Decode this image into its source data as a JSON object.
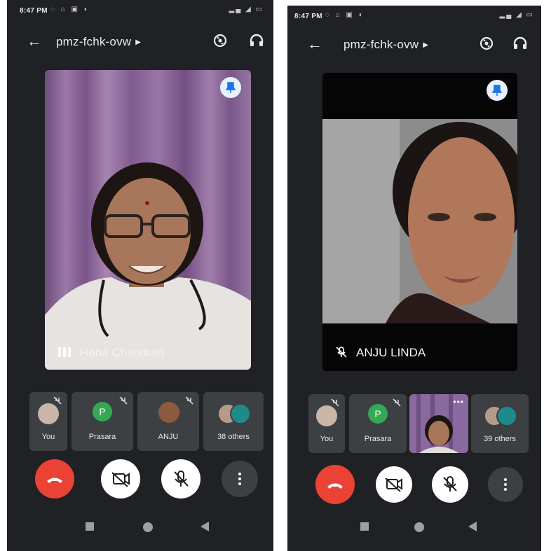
{
  "left": {
    "status_time": "8:47 PM",
    "meeting_code": "pmz-fchk-ovw",
    "speaker_name": "Hena Chandran",
    "tiles": [
      {
        "label": "You"
      },
      {
        "label": "Prasara",
        "initial": "P"
      },
      {
        "label": "ANJU"
      },
      {
        "label": "38 others"
      }
    ]
  },
  "right": {
    "status_time": "8:47 PM",
    "meeting_code": "pmz-fchk-ovw",
    "speaker_name": "ANJU LINDA",
    "tiles": [
      {
        "label": "You"
      },
      {
        "label": "Prasara",
        "initial": "P"
      },
      {
        "label": ""
      },
      {
        "label": "39 others"
      }
    ]
  },
  "colors": {
    "background": "#202124",
    "tile": "#3c4043",
    "end_call": "#ea4335",
    "pin": "#e8f0fe",
    "pin_icon": "#1a73e8",
    "avatar_green": "#34a853"
  },
  "icons": [
    "back-arrow-icon",
    "switch-camera-icon",
    "headphones-icon",
    "pin-icon",
    "end-call-icon",
    "camera-off-icon",
    "mic-off-icon",
    "more-vert-icon",
    "audio-wave-icon"
  ]
}
